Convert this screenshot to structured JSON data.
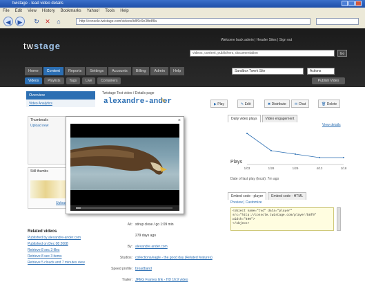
{
  "browser": {
    "title": "twistage - lead video details",
    "menu": [
      "File",
      "Edit",
      "View",
      "History",
      "Bookmarks",
      "Yahoo!",
      "Tools",
      "Help"
    ],
    "url": "http://console.twistage.com/videos/b8f0c9e3fbdf8a"
  },
  "site": {
    "logo_a": "tw",
    "logo_b": "stage",
    "user_line": "Welcome back  admin  |  Header Sites  |  Sign out",
    "search_placeholder": "videos, content, publishers, documentation",
    "go_label": "Go",
    "tabs": [
      "Home",
      "Content",
      "Reports",
      "Settings",
      "Accounts",
      "Billing",
      "Admin",
      "Help"
    ],
    "active_tab": "Content",
    "site_select": "Sandbox Twerk Site",
    "site_select2": "Actions",
    "subtabs": [
      "Videos",
      "Playlists",
      "Tags",
      "Live",
      "Containers"
    ],
    "publish_label": "Publish Video"
  },
  "left": {
    "overview": "Overview",
    "video_analytics": "Video Analytics",
    "thumbnails_label": "Thumbnails",
    "thumb_subline": "Upload new",
    "waveform_label": "Still thumbs",
    "upload_label": "Upload",
    "related_title": "Related videos",
    "related": [
      "Published by alexandre-ander.com",
      "Published on Dec 08 2008",
      "Retrieve 8 sec 3 files",
      "Retrieve 8 sec 3 items",
      "Retrieve 5 clouds and 7 minutes view"
    ]
  },
  "main": {
    "breadcrumb": "Twistage Test video / Details page",
    "title": "alexandre-ander",
    "meta": [
      {
        "label": "Alt:",
        "value": "stirup close / go 1:09 min"
      },
      {
        "label": "",
        "value": "279 days ago"
      },
      {
        "label": "By:",
        "value": "alexandre.ander.com"
      },
      {
        "label": "Studios:",
        "value": "collections/eagle - the good day (Related features)"
      },
      {
        "label": "Speed profile:",
        "value": "broadband"
      },
      {
        "label": "Trailer:",
        "value": "JPEG Frames link - HD 16:9 video"
      }
    ]
  },
  "actions": [
    "Play",
    "Edit",
    "Distribute",
    "Chat",
    "Delete"
  ],
  "right": {
    "tabs": [
      "Daily video plays",
      "Video engagement"
    ],
    "view_details": "View details",
    "chart_foot": "Date of last play (local): 7m ago",
    "embed_tabs": [
      "Embed code - player",
      "Embed code - HTML"
    ],
    "embed_links": "Preview  |  Customize",
    "code": "<object name=\"tvd\" data=\"player\"\nsrc=\"http://console.twistage.com/player/b8f0\"\nwidth=\"400\">\n</object>"
  },
  "chart_data": {
    "type": "line",
    "categories": [
      "1/03",
      "1/28",
      "1/29",
      "4/13",
      "1/18"
    ],
    "values": [
      45,
      20,
      15,
      10,
      10
    ],
    "ylabel": "Plays",
    "ylim": [
      0,
      50
    ],
    "grid": false
  },
  "popup": {
    "close": "×",
    "progress": 0.05
  }
}
